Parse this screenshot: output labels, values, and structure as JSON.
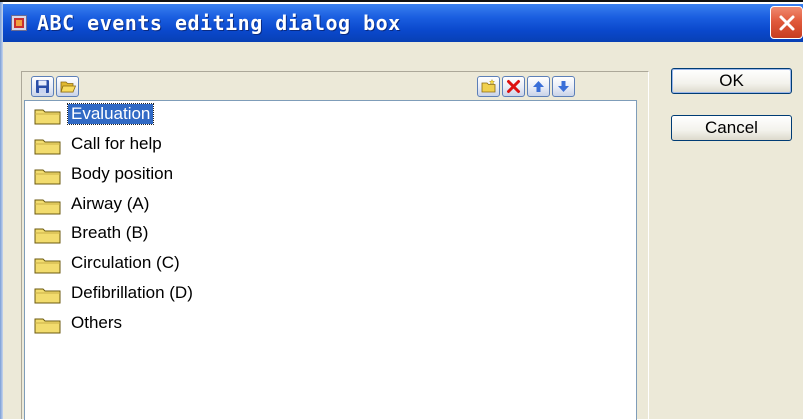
{
  "window": {
    "title": "ABC events editing dialog box"
  },
  "toolbar": {
    "left_buttons": [
      {
        "icon": "save-icon"
      },
      {
        "icon": "open-folder-icon"
      }
    ],
    "right_buttons": [
      {
        "icon": "new-folder-icon"
      },
      {
        "icon": "delete-icon"
      },
      {
        "icon": "move-up-icon"
      },
      {
        "icon": "move-down-icon"
      }
    ]
  },
  "events": {
    "items": [
      {
        "label": "Evaluation",
        "selected": true
      },
      {
        "label": "Call for help",
        "selected": false
      },
      {
        "label": "Body position",
        "selected": false
      },
      {
        "label": "Airway (A)",
        "selected": false
      },
      {
        "label": "Breath (B)",
        "selected": false
      },
      {
        "label": "Circulation (C)",
        "selected": false
      },
      {
        "label": "Defibrillation (D)",
        "selected": false
      },
      {
        "label": "Others",
        "selected": false
      }
    ]
  },
  "buttons": {
    "ok": "OK",
    "cancel": "Cancel"
  },
  "colors": {
    "titlebar": "#0a48cc",
    "selection": "#316ac5",
    "dialog_bg": "#ece9d8",
    "close_button": "#e15a3c",
    "folder_yellow": "#f2dc6e"
  }
}
